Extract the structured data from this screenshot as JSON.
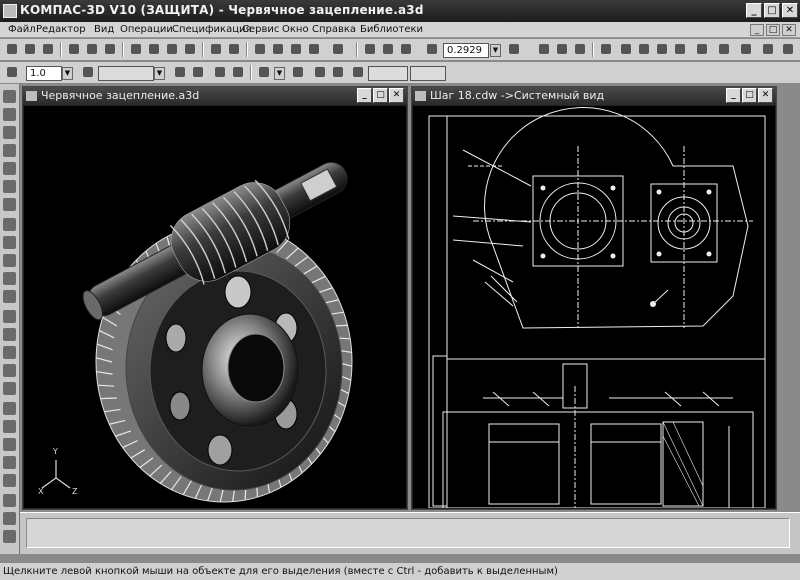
{
  "app": {
    "title": "КОМПАС-3D V10 (ЗАЩИТА) - Червячное зацепление.a3d"
  },
  "window_controls": {
    "minimize": "_",
    "maximize": "□",
    "close": "✕"
  },
  "menu": {
    "items": [
      "Файл",
      "Редактор",
      "Вид",
      "Операции",
      "Спецификация",
      "Сервис",
      "Окно",
      "Справка",
      "Библиотеки"
    ]
  },
  "toolbar": {
    "zoom_value": "0.2929",
    "line_scale_value": "1.0",
    "snap_field_value": "",
    "style_field_value": ""
  },
  "documents": [
    {
      "title": "Червячное зацепление.a3d"
    },
    {
      "title": "Шаг 18.cdw ->Системный вид"
    }
  ],
  "axis_labels": {
    "x": "X",
    "y": "Y",
    "z": "Z"
  },
  "status": {
    "text": "Щелкните левой кнопкой мыши на объекте для его выделения (вместе с Ctrl - добавить к выделенным)"
  },
  "icons": {
    "toolbar": [
      "new-icon",
      "open-icon",
      "save-icon",
      "print-icon",
      "preview-icon",
      "cut-icon",
      "copy-icon",
      "paste-icon",
      "format-icon",
      "undo-icon",
      "redo-icon",
      "properties-icon",
      "variables-icon",
      "help-icon",
      "zoom-window-icon",
      "zoom-in-icon",
      "zoom-out-icon",
      "zoom-scale-icon",
      "pan-icon",
      "rotate-icon",
      "view-orientation-icon",
      "shaded-icon",
      "wireframe-icon",
      "hidden-lines-icon"
    ]
  },
  "colors": {
    "titlebar": "#2a2a2a",
    "viewport": "#000000",
    "panel": "#d0d0d0"
  }
}
